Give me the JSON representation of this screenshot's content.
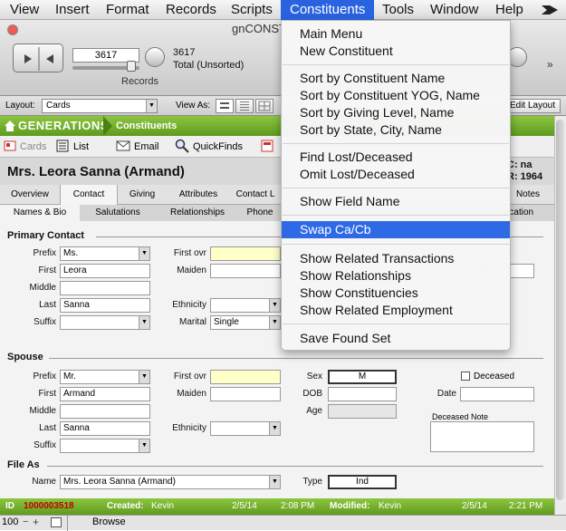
{
  "menubar": {
    "items": [
      "View",
      "Insert",
      "Format",
      "Records",
      "Scripts",
      "Constituents",
      "Tools",
      "Window",
      "Help"
    ]
  },
  "window": {
    "title": "gnCONST"
  },
  "toolbar": {
    "record_number": "3617",
    "records_label": "Records",
    "found_count": "3617",
    "found_status": "Total (Unsorted)"
  },
  "layoutbar": {
    "layout_label": "Layout:",
    "layout_value": "Cards",
    "view_as_label": "View As:",
    "edit_layout": "Edit Layout"
  },
  "header": {
    "app_name": "GENERATIONS",
    "module": "Constituents"
  },
  "nav": {
    "cards": "Cards",
    "list": "List",
    "email": "Email",
    "quickfinds": "QuickFinds"
  },
  "record": {
    "name": "Mrs. Leora Sanna (Armand)",
    "code_line": "C: na",
    "yog_line": "R: 1964"
  },
  "tabs1": [
    "Overview",
    "Contact",
    "Giving",
    "Attributes",
    "Contact L",
    "Notes"
  ],
  "tabs2": [
    "Names & Bio",
    "Salutations",
    "Relationships",
    "Phone",
    "ucation"
  ],
  "primary": {
    "section": "Primary Contact",
    "prefix_label": "Prefix",
    "prefix": "Ms.",
    "first_label": "First",
    "first": "Leora",
    "middle_label": "Middle",
    "middle": "",
    "last_label": "Last",
    "last": "Sanna",
    "suffix_label": "Suffix",
    "suffix": "",
    "first_ovr_label": "First ovr",
    "maiden_label": "Maiden",
    "ethnicity_label": "Ethnicity",
    "marital_label": "Marital",
    "marital": "Single"
  },
  "spouse": {
    "section": "Spouse",
    "prefix_label": "Prefix",
    "prefix": "Mr.",
    "first_label": "First",
    "first": "Armand",
    "middle_label": "Middle",
    "middle": "",
    "last_label": "Last",
    "last": "Sanna",
    "suffix_label": "Suffix",
    "suffix": "",
    "first_ovr_label": "First ovr",
    "maiden_label": "Maiden",
    "ethnicity_label": "Ethnicity",
    "sex_label": "Sex",
    "sex": "M",
    "dob_label": "DOB",
    "age_label": "Age",
    "deceased_label": "Deceased",
    "date_label": "Date",
    "deceased_note_label": "Deceased Note"
  },
  "fileas": {
    "section": "File As",
    "name_label": "Name",
    "name": "Mrs. Leora Sanna (Armand)",
    "type_label": "Type",
    "type": "Ind"
  },
  "status": {
    "id_label": "ID",
    "id": "1000003518",
    "created_label": "Created:",
    "created_by": "Kevin",
    "created_date": "2/5/14",
    "created_time": "2:08 PM",
    "modified_label": "Modified:",
    "modified_by": "Kevin",
    "modified_date": "2/5/14",
    "modified_time": "2:21 PM"
  },
  "bottom": {
    "zoom": "100",
    "mode": "Browse"
  },
  "dropdown": {
    "items": [
      "Main Menu",
      "New Constituent",
      "Sort by Constituent Name",
      "Sort by Constituent YOG, Name",
      "Sort by Giving Level, Name",
      "Sort by State, City, Name",
      "Find Lost/Deceased",
      "Omit Lost/Deceased",
      "Show Field Name",
      "Swap Ca/Cb",
      "Show Related Transactions",
      "Show Relationships",
      "Show Constituencies",
      "Show Related Employment",
      "Save Found Set"
    ]
  }
}
